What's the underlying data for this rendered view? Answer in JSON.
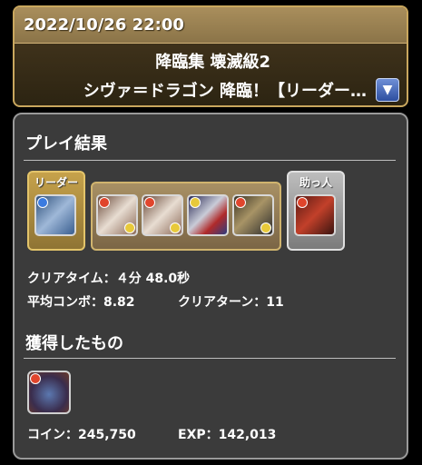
{
  "header": {
    "datetime": "2022/10/26 22:00",
    "title": "降臨集 壊滅級2",
    "subtitle": "シヴァ＝ドラゴン 降臨！【リーダー…",
    "dropdown_icon": "chevron-down-icon"
  },
  "result": {
    "title": "プレイ結果",
    "leader_label": "リーダー",
    "helper_label": "助っ人",
    "clear_time": "クリアタイム：４分 48.0秒",
    "avg_combo": "平均コンボ：8.82",
    "clear_turns": "クリアターン：11"
  },
  "rewards": {
    "title": "獲得したもの",
    "coins": "コイン：245,750",
    "exp": "EXP：142,013"
  },
  "colors": {
    "gold_border": "#c9a75e",
    "panel_bg": "#3b3b3b",
    "fire": "#e0452c",
    "light": "#e8c93a",
    "water": "#3b7be0",
    "dark": "#8a4ad0"
  }
}
